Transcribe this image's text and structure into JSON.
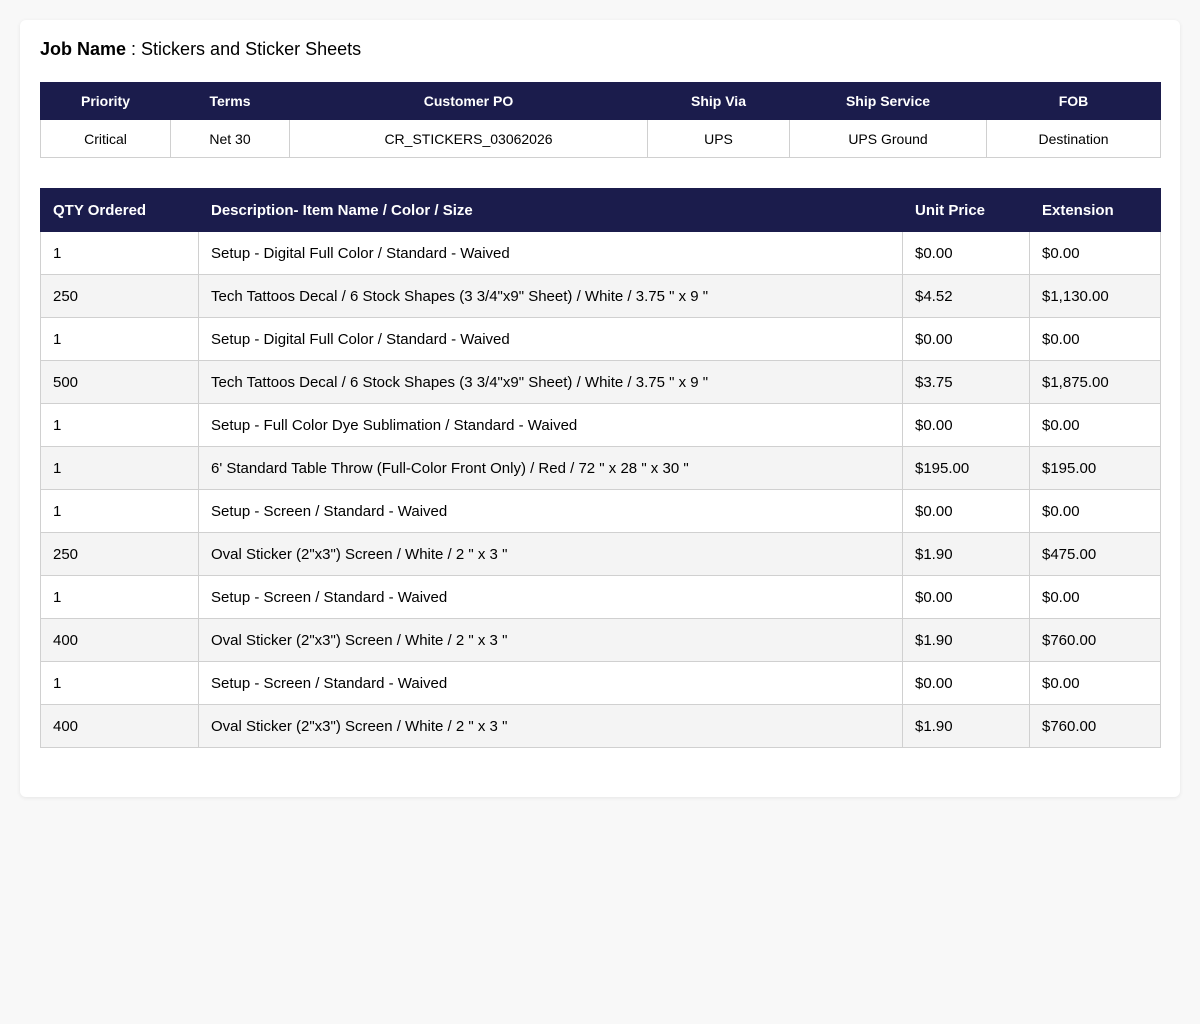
{
  "job": {
    "label": "Job Name",
    "separator": " : ",
    "value": "Stickers and Sticker Sheets"
  },
  "order_info": {
    "headers": [
      "Priority",
      "Terms",
      "Customer PO",
      "Ship Via",
      "Ship Service",
      "FOB"
    ],
    "values": [
      "Critical",
      "Net 30",
      "CR_STICKERS_03062026",
      "UPS",
      "UPS Ground",
      "Destination"
    ]
  },
  "items": {
    "headers": [
      "QTY Ordered",
      "Description- Item Name / Color / Size",
      "Unit Price",
      "Extension"
    ],
    "rows": [
      {
        "qty": "1",
        "desc": "Setup - Digital Full Color / Standard - Waived",
        "unit": "$0.00",
        "ext": "$0.00"
      },
      {
        "qty": "250",
        "desc": "Tech Tattoos Decal / 6 Stock Shapes (3 3/4\"x9\" Sheet) / White / 3.75 \" x 9 \"",
        "unit": "$4.52",
        "ext": "$1,130.00"
      },
      {
        "qty": "1",
        "desc": "Setup - Digital Full Color / Standard - Waived",
        "unit": "$0.00",
        "ext": "$0.00"
      },
      {
        "qty": "500",
        "desc": "Tech Tattoos Decal / 6 Stock Shapes (3 3/4\"x9\" Sheet) / White / 3.75 \" x 9 \"",
        "unit": "$3.75",
        "ext": "$1,875.00"
      },
      {
        "qty": "1",
        "desc": "Setup - Full Color Dye Sublimation / Standard - Waived",
        "unit": "$0.00",
        "ext": "$0.00"
      },
      {
        "qty": "1",
        "desc": "6' Standard Table Throw (Full-Color Front Only) / Red / 72 \" x 28 \" x 30 \"",
        "unit": "$195.00",
        "ext": "$195.00"
      },
      {
        "qty": "1",
        "desc": "Setup - Screen / Standard - Waived",
        "unit": "$0.00",
        "ext": "$0.00"
      },
      {
        "qty": "250",
        "desc": "Oval Sticker (2\"x3\") Screen / White / 2 \" x 3 \"",
        "unit": "$1.90",
        "ext": "$475.00"
      },
      {
        "qty": "1",
        "desc": "Setup - Screen / Standard - Waived",
        "unit": "$0.00",
        "ext": "$0.00"
      },
      {
        "qty": "400",
        "desc": "Oval Sticker (2\"x3\") Screen / White / 2 \" x 3 \"",
        "unit": "$1.90",
        "ext": "$760.00"
      },
      {
        "qty": "1",
        "desc": "Setup - Screen / Standard - Waived",
        "unit": "$0.00",
        "ext": "$0.00"
      },
      {
        "qty": "400",
        "desc": "Oval Sticker (2\"x3\") Screen / White / 2 \" x 3 \"",
        "unit": "$1.90",
        "ext": "$760.00"
      }
    ]
  },
  "colors": {
    "header_bg": "#1b1c4c",
    "header_text": "#ffffff",
    "row_alt": "#f4f4f4",
    "page_bg": "#f8f8f8"
  }
}
